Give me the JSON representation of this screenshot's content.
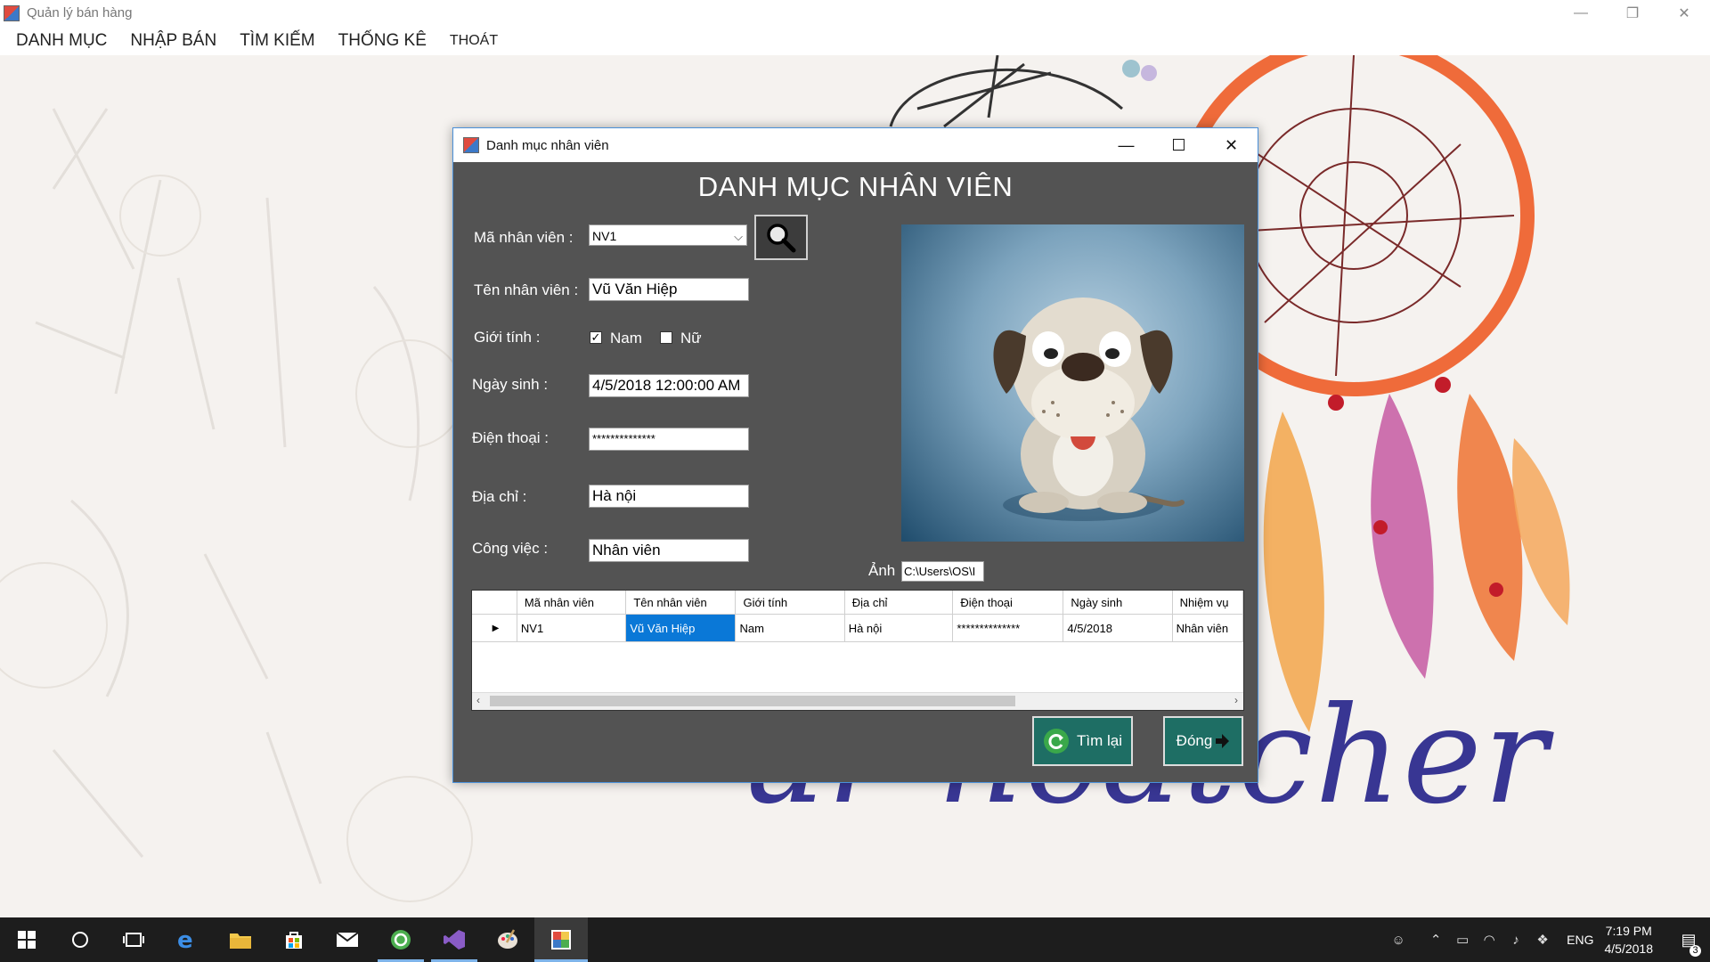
{
  "main_window": {
    "title": "Quản lý bán hàng",
    "controls": {
      "minimize": "—",
      "restore": "❐",
      "close": "✕"
    }
  },
  "menu": [
    "DANH MỤC",
    "NHẬP BÁN",
    "TÌM KIẾM",
    "THỐNG KÊ",
    "THOÁT"
  ],
  "background": {
    "script_text": "ur   ncatcher"
  },
  "dialog": {
    "title": "Danh mục nhân viên",
    "controls": {
      "minimize": "—",
      "maximize": "☐",
      "close": "✕"
    },
    "heading": "DANH MỤC NHÂN VIÊN",
    "labels": {
      "ma_nv": "Mã nhân viên :",
      "ten_nv": "Tên nhân viên :",
      "gioi_tinh": "Giới tính :",
      "ngay_sinh": "Ngày sinh :",
      "dien_thoai": "Điện thoại :",
      "dia_chi": "Địa chỉ :",
      "cong_viec": "Công việc :",
      "anh": "Ảnh"
    },
    "values": {
      "ma_nv": "NV1",
      "ten_nv": "Vũ Văn Hiệp",
      "nam_label": "Nam",
      "nam_checked": true,
      "nu_label": "Nữ",
      "nu_checked": false,
      "ngay_sinh": "4/5/2018 12:00:00 AM",
      "dien_thoai": "**************",
      "dia_chi": "Hà nội",
      "cong_viec": "Nhân viên",
      "anh": "C:\\Users\\OS\\I"
    },
    "grid": {
      "columns": [
        "Mã nhân viên",
        "Tên nhân viên",
        "Giới tính",
        "Địa chỉ",
        "Điện thoại",
        "Ngày sinh",
        "Nhiệm vụ"
      ],
      "rows": [
        {
          "indicator": "▶",
          "cells": [
            "NV1",
            "Vũ Văn Hiệp",
            "Nam",
            "Hà nội",
            "**************",
            "4/5/2018",
            "Nhân viên"
          ]
        }
      ]
    },
    "buttons": {
      "reset": "Tìm lại",
      "close": "Đóng"
    }
  },
  "taskbar": {
    "lang": "ENG",
    "time": "7:19 PM",
    "date": "4/5/2018",
    "notifications": "3"
  }
}
